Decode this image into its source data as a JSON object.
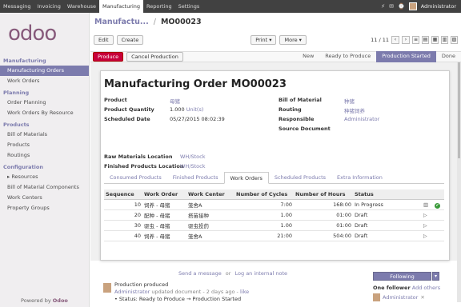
{
  "topbar": {
    "menu": [
      "Messaging",
      "Invoicing",
      "Warehouse",
      "Manufacturing",
      "Reporting",
      "Settings"
    ],
    "user": "Administrator"
  },
  "sidebar": {
    "logo": "odoo",
    "sections": [
      {
        "head": "Manufacturing",
        "items": [
          "Manufacturing Orders",
          "Work Orders"
        ]
      },
      {
        "head": "Planning",
        "items": [
          "Order Planning",
          "Work Orders By Resource"
        ]
      },
      {
        "head": "Products",
        "items": [
          "Bill of Materials",
          "Products",
          "Routings"
        ]
      },
      {
        "head": "Configuration",
        "items": [
          "▸ Resources",
          "Bill of Material Components",
          "Work Centers",
          "Property Groups"
        ]
      }
    ],
    "powered": "Powered by",
    "powered_brand": "Odoo"
  },
  "breadcrumb": {
    "parent": "Manufactu...",
    "sep": "/",
    "current": "MO00023"
  },
  "toolbar": {
    "edit": "Edit",
    "create": "Create",
    "print": "Print ▾",
    "more": "More ▾",
    "pager": "11 / 11"
  },
  "status": {
    "produce": "Produce",
    "cancel": "Cancel Production",
    "steps": [
      "New",
      "Ready to Produce",
      "Production Started",
      "Done"
    ],
    "active_step": "Production Started"
  },
  "form": {
    "title_prefix": "Manufacturing Order",
    "title_ref": "MO00023",
    "product_label": "Product",
    "product": "母猪",
    "qty_label": "Product Quantity",
    "qty": "1.000",
    "qty_unit": "Unit(s)",
    "date_label": "Scheduled Date",
    "date": "05/27/2015 08:02:39",
    "bom_label": "Bill of Material",
    "bom": "种猪",
    "routing_label": "Routing",
    "routing": "种猪饲养",
    "resp_label": "Responsible",
    "resp": "Administrator",
    "src_label": "Source Document",
    "src": "",
    "raw_loc_label": "Raw Materials Location",
    "raw_loc": "WH/Stock",
    "fin_loc_label": "Finished Products Location",
    "fin_loc": "WH/Stock"
  },
  "tabs": [
    "Consumed Products",
    "Finished Products",
    "Work Orders",
    "Scheduled Products",
    "Extra Information"
  ],
  "work_orders": {
    "headers": [
      "Sequence",
      "Work Order",
      "Work Center",
      "Number of Cycles",
      "Number of Hours",
      "Status"
    ],
    "rows": [
      {
        "seq": "10",
        "wo": "饲养 - 母猪",
        "wc": "笼舍A",
        "cycles": "7:00",
        "hours": "168:00",
        "status": "In Progress"
      },
      {
        "seq": "20",
        "wo": "配种 - 母猪",
        "wc": "搭苗接种",
        "cycles": "1.00",
        "hours": "01:00",
        "status": "Draft"
      },
      {
        "seq": "30",
        "wo": "驱虫 - 母猪",
        "wc": "驱虫投药",
        "cycles": "1.00",
        "hours": "01:00",
        "status": "Draft"
      },
      {
        "seq": "40",
        "wo": "饲养 - 母猪",
        "wc": "笼舍A",
        "cycles": "21:00",
        "hours": "504:00",
        "status": "Draft"
      }
    ]
  },
  "chatter": {
    "send": "Send a message",
    "or": "or",
    "log": "Log an internal note",
    "following": "Following",
    "msg_title": "Production produced",
    "msg_author": "Administrator",
    "msg_meta": "updated document - 2 days ago -",
    "msg_like": "like",
    "msg_change": "• Status: Ready to Produce → Production Started",
    "followers_count": "One follower",
    "add_others": "Add others",
    "follower": "Administrator"
  }
}
